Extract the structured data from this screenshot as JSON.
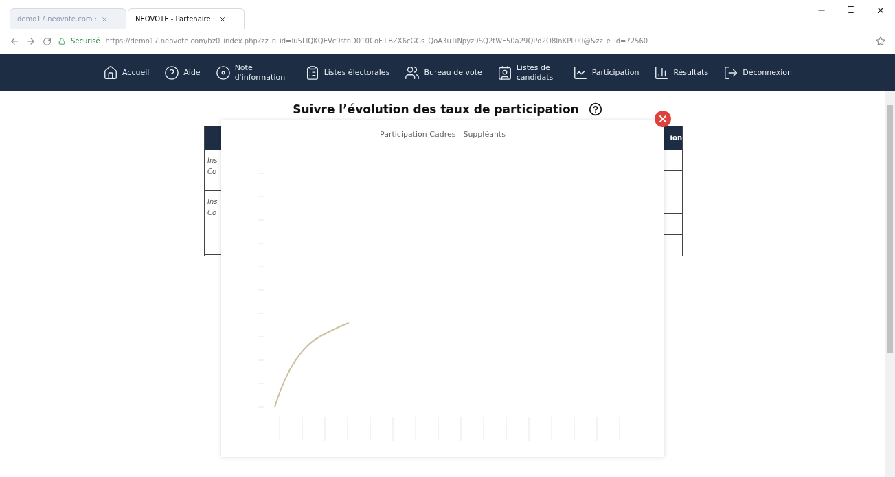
{
  "browser": {
    "tabs": [
      {
        "label": "demo17.neovote.com : ",
        "selected": false
      },
      {
        "label": "NEOVOTE - Partenaire :",
        "selected": true
      }
    ],
    "security": "Sécurisé",
    "url": "https://demo17.neovote.com/bz0_index.php?zz_n_id=lu5LlQKQEVc9stnD010CoF+BZX6cGGs_QoA3uTiNpyz9SQ2tWF50a29QPd2O8InKPL00@&zz_e_id=72560"
  },
  "nav": [
    {
      "kind": "home",
      "label": "Accueil"
    },
    {
      "kind": "help",
      "label": "Aide"
    },
    {
      "kind": "note",
      "label": "Note d'information"
    },
    {
      "kind": "lists",
      "label": "Listes électorales"
    },
    {
      "kind": "bureau",
      "label": "Bureau de vote"
    },
    {
      "kind": "candidates",
      "label": "Listes de candidats"
    },
    {
      "kind": "participation",
      "label": "Participation"
    },
    {
      "kind": "results",
      "label": "Résultats"
    },
    {
      "kind": "logout",
      "label": "Déconnexion"
    }
  ],
  "page_title": "Suivre l’évolution des taux de participation",
  "table": {
    "header_right": "ion",
    "left_cells": [
      [
        "Ins",
        "Co"
      ],
      [
        "Ins",
        "Co"
      ],
      []
    ]
  },
  "modal": {
    "title": "Participation Cadres - Suppléants"
  }
}
